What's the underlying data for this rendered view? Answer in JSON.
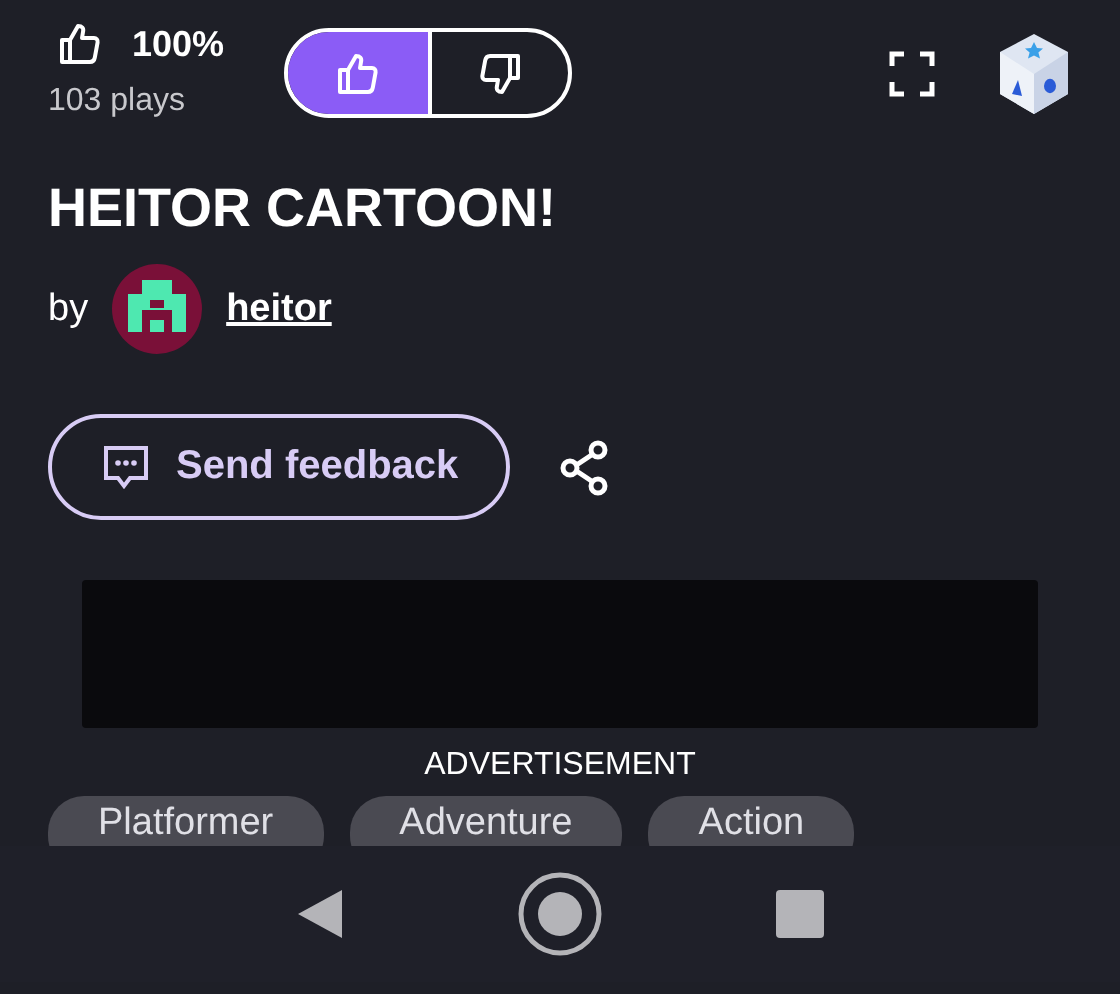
{
  "rating": {
    "percent": "100%",
    "plays": "103 plays"
  },
  "vote_buttons": [
    {
      "kind": "up",
      "selected": true
    },
    {
      "kind": "down",
      "selected": false
    }
  ],
  "title": "HEITOR CARTOON!",
  "author": {
    "prefix": "by",
    "name": "heitor"
  },
  "feedback_button": "Send feedback",
  "advertisement_label": "ADVERTISEMENT",
  "tags": [
    "Platformer",
    "Adventure",
    "Action"
  ]
}
